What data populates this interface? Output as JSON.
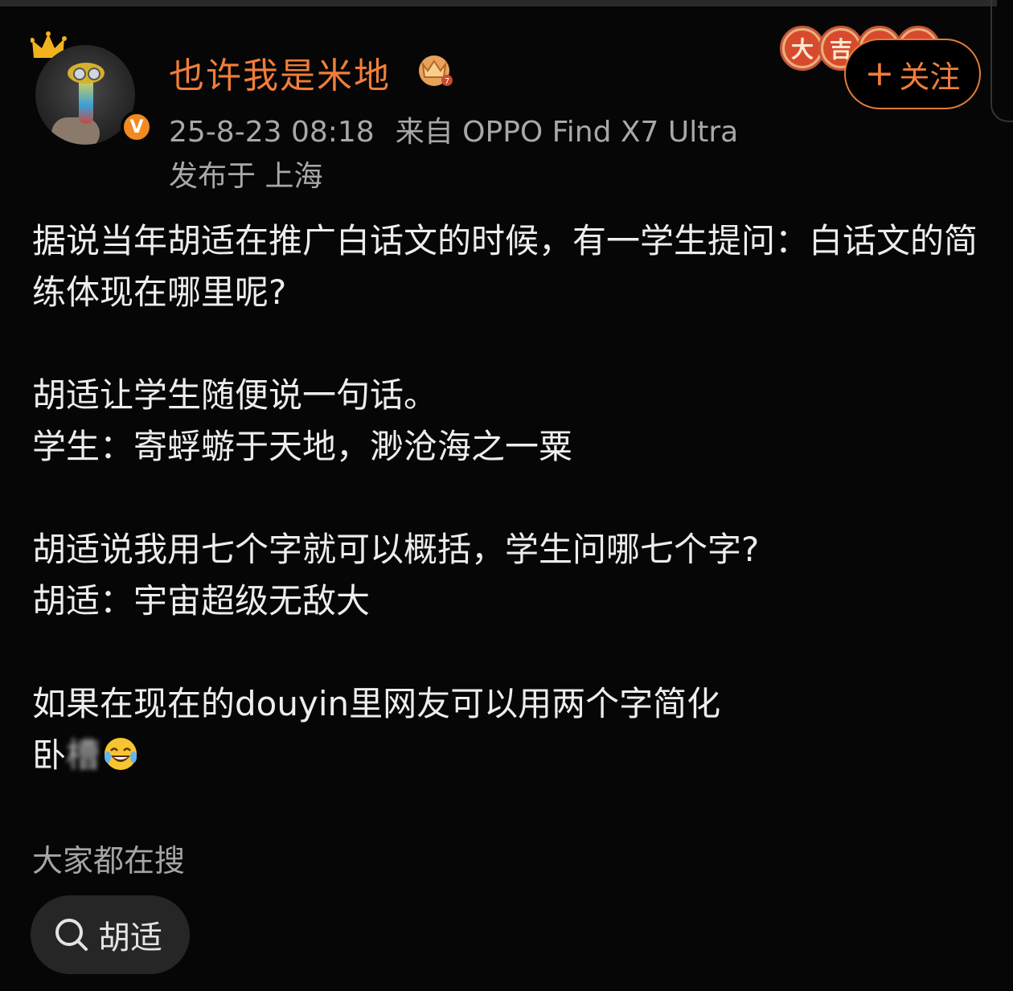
{
  "user": {
    "name": "也许我是米地",
    "verified_badge": "V"
  },
  "meta": {
    "timestamp": "25-8-23 08:18",
    "source": "来自 OPPO Find X7 Ultra",
    "location": "发布于 上海"
  },
  "badges": [
    "大",
    "吉"
  ],
  "follow_button": {
    "icon": "+",
    "label": "关注"
  },
  "post": {
    "paragraph1": "据说当年胡适在推广白话文的时候，有一学生提问：白话文的简练体现在哪里呢?",
    "line2a": "胡适让学生随便说一句话。",
    "line2b": "学生：寄蜉蝣于天地，渺沧海之一粟",
    "line3a": "胡适说我用七个字就可以概括，学生问哪七个字?",
    "line3b": "胡适：宇宙超级无敌大",
    "line4a": "如果在现在的douyin里网友可以用两个字简化",
    "line4b_visible": "卧",
    "line4b_obscured": "槽"
  },
  "search": {
    "heading": "大家都在搜",
    "chip_label": "胡适"
  },
  "colors": {
    "accent": "#F07E3A",
    "background": "#060606",
    "meta_text": "#A8A8A8"
  }
}
